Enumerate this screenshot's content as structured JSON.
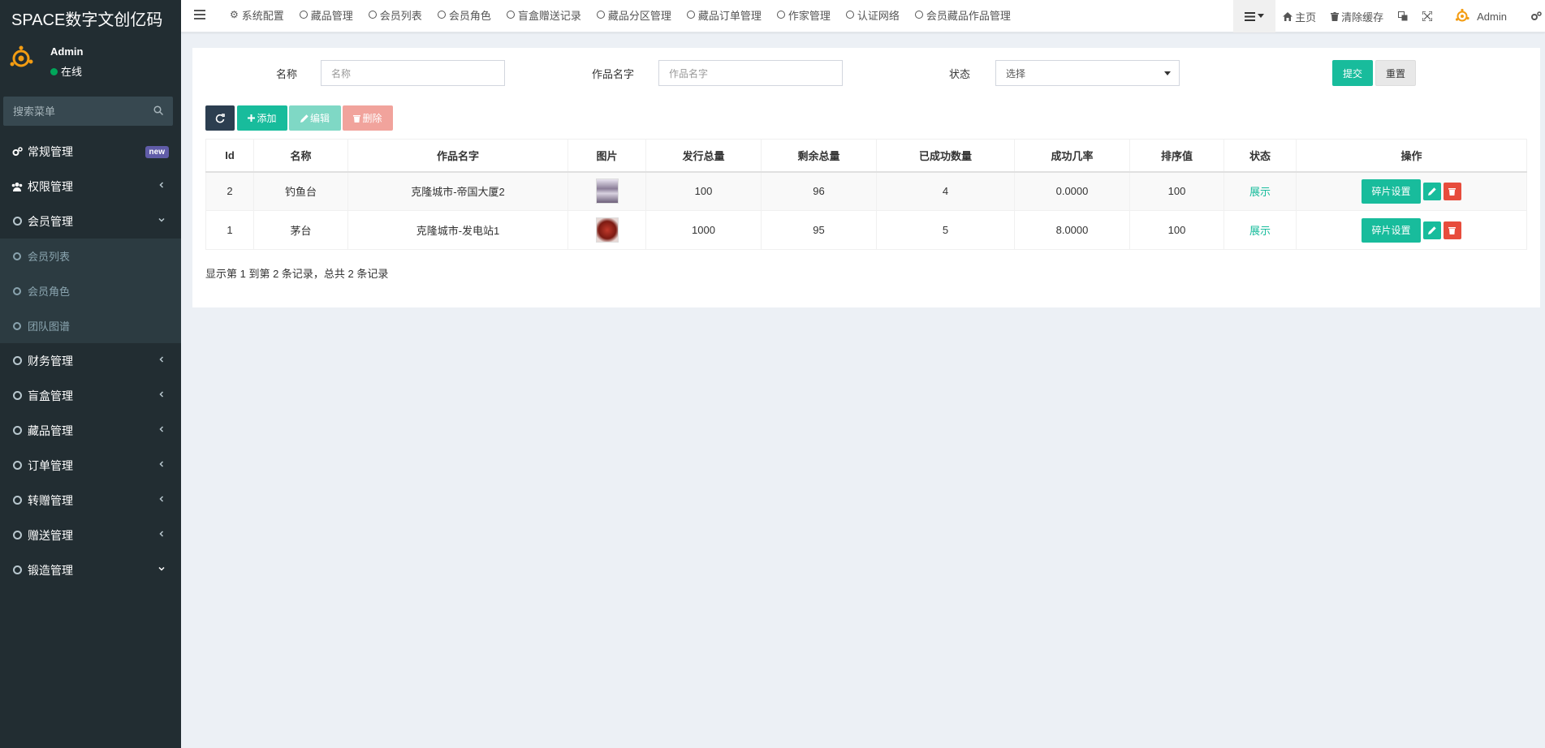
{
  "app": {
    "brand": "SPACE数字文创亿码"
  },
  "user": {
    "name": "Admin",
    "status": "在线"
  },
  "sidebar": {
    "search_placeholder": "搜索菜单",
    "items": [
      {
        "label": "常规管理",
        "badge": "new"
      },
      {
        "label": "权限管理"
      },
      {
        "label": "会员管理"
      },
      {
        "label": "会员列表"
      },
      {
        "label": "会员角色"
      },
      {
        "label": "团队图谱"
      },
      {
        "label": "财务管理"
      },
      {
        "label": "盲盒管理"
      },
      {
        "label": "藏品管理"
      },
      {
        "label": "订单管理"
      },
      {
        "label": "转赠管理"
      },
      {
        "label": "赠送管理"
      },
      {
        "label": "锻造管理"
      }
    ]
  },
  "topbar": {
    "tabs": [
      "系统配置",
      "藏品管理",
      "会员列表",
      "会员角色",
      "盲盒赠送记录",
      "藏品分区管理",
      "藏品订单管理",
      "作家管理",
      "认证网络",
      "会员藏品作品管理"
    ],
    "home": "主页",
    "clear_cache": "清除缓存",
    "user": "Admin"
  },
  "filters": {
    "name_label": "名称",
    "name_placeholder": "名称",
    "work_label": "作品名字",
    "work_placeholder": "作品名字",
    "status_label": "状态",
    "status_value": "选择",
    "submit": "提交",
    "reset": "重置"
  },
  "toolbar": {
    "add": "添加",
    "edit": "编辑",
    "delete": "删除"
  },
  "table": {
    "headers": [
      "Id",
      "名称",
      "作品名字",
      "图片",
      "发行总量",
      "剩余总量",
      "已成功数量",
      "成功几率",
      "排序值",
      "状态",
      "操作"
    ],
    "rows": [
      {
        "id": "2",
        "name": "钓鱼台",
        "work": "克隆城市-帝国大厦2",
        "issued": "100",
        "remaining": "96",
        "success": "4",
        "rate": "0.0000",
        "sort": "100",
        "status": "展示",
        "op": "碎片设置"
      },
      {
        "id": "1",
        "name": "茅台",
        "work": "克隆城市-发电站1",
        "issued": "1000",
        "remaining": "95",
        "success": "5",
        "rate": "8.0000",
        "sort": "100",
        "status": "展示",
        "op": "碎片设置"
      }
    ]
  },
  "records": "显示第 1 到第 2 条记录，总共 2 条记录",
  "colors": {
    "sidebar": "#222d32",
    "accent": "#18bc9c",
    "danger": "#e74c3c",
    "badge": "#605ca8"
  }
}
